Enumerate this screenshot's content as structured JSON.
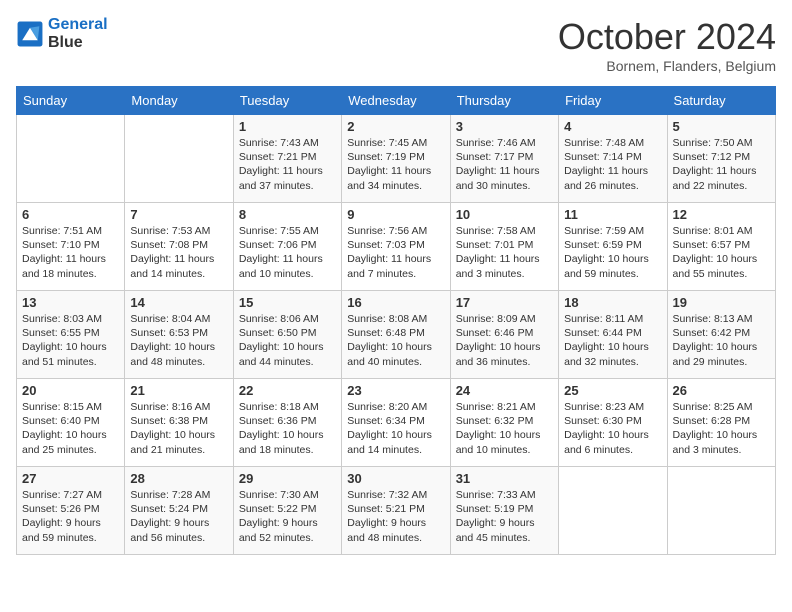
{
  "header": {
    "logo_line1": "General",
    "logo_line2": "Blue",
    "month": "October 2024",
    "location": "Bornem, Flanders, Belgium"
  },
  "days_of_week": [
    "Sunday",
    "Monday",
    "Tuesday",
    "Wednesday",
    "Thursday",
    "Friday",
    "Saturday"
  ],
  "weeks": [
    [
      {
        "day": "",
        "sunrise": "",
        "sunset": "",
        "daylight": ""
      },
      {
        "day": "",
        "sunrise": "",
        "sunset": "",
        "daylight": ""
      },
      {
        "day": "1",
        "sunrise": "Sunrise: 7:43 AM",
        "sunset": "Sunset: 7:21 PM",
        "daylight": "Daylight: 11 hours and 37 minutes."
      },
      {
        "day": "2",
        "sunrise": "Sunrise: 7:45 AM",
        "sunset": "Sunset: 7:19 PM",
        "daylight": "Daylight: 11 hours and 34 minutes."
      },
      {
        "day": "3",
        "sunrise": "Sunrise: 7:46 AM",
        "sunset": "Sunset: 7:17 PM",
        "daylight": "Daylight: 11 hours and 30 minutes."
      },
      {
        "day": "4",
        "sunrise": "Sunrise: 7:48 AM",
        "sunset": "Sunset: 7:14 PM",
        "daylight": "Daylight: 11 hours and 26 minutes."
      },
      {
        "day": "5",
        "sunrise": "Sunrise: 7:50 AM",
        "sunset": "Sunset: 7:12 PM",
        "daylight": "Daylight: 11 hours and 22 minutes."
      }
    ],
    [
      {
        "day": "6",
        "sunrise": "Sunrise: 7:51 AM",
        "sunset": "Sunset: 7:10 PM",
        "daylight": "Daylight: 11 hours and 18 minutes."
      },
      {
        "day": "7",
        "sunrise": "Sunrise: 7:53 AM",
        "sunset": "Sunset: 7:08 PM",
        "daylight": "Daylight: 11 hours and 14 minutes."
      },
      {
        "day": "8",
        "sunrise": "Sunrise: 7:55 AM",
        "sunset": "Sunset: 7:06 PM",
        "daylight": "Daylight: 11 hours and 10 minutes."
      },
      {
        "day": "9",
        "sunrise": "Sunrise: 7:56 AM",
        "sunset": "Sunset: 7:03 PM",
        "daylight": "Daylight: 11 hours and 7 minutes."
      },
      {
        "day": "10",
        "sunrise": "Sunrise: 7:58 AM",
        "sunset": "Sunset: 7:01 PM",
        "daylight": "Daylight: 11 hours and 3 minutes."
      },
      {
        "day": "11",
        "sunrise": "Sunrise: 7:59 AM",
        "sunset": "Sunset: 6:59 PM",
        "daylight": "Daylight: 10 hours and 59 minutes."
      },
      {
        "day": "12",
        "sunrise": "Sunrise: 8:01 AM",
        "sunset": "Sunset: 6:57 PM",
        "daylight": "Daylight: 10 hours and 55 minutes."
      }
    ],
    [
      {
        "day": "13",
        "sunrise": "Sunrise: 8:03 AM",
        "sunset": "Sunset: 6:55 PM",
        "daylight": "Daylight: 10 hours and 51 minutes."
      },
      {
        "day": "14",
        "sunrise": "Sunrise: 8:04 AM",
        "sunset": "Sunset: 6:53 PM",
        "daylight": "Daylight: 10 hours and 48 minutes."
      },
      {
        "day": "15",
        "sunrise": "Sunrise: 8:06 AM",
        "sunset": "Sunset: 6:50 PM",
        "daylight": "Daylight: 10 hours and 44 minutes."
      },
      {
        "day": "16",
        "sunrise": "Sunrise: 8:08 AM",
        "sunset": "Sunset: 6:48 PM",
        "daylight": "Daylight: 10 hours and 40 minutes."
      },
      {
        "day": "17",
        "sunrise": "Sunrise: 8:09 AM",
        "sunset": "Sunset: 6:46 PM",
        "daylight": "Daylight: 10 hours and 36 minutes."
      },
      {
        "day": "18",
        "sunrise": "Sunrise: 8:11 AM",
        "sunset": "Sunset: 6:44 PM",
        "daylight": "Daylight: 10 hours and 32 minutes."
      },
      {
        "day": "19",
        "sunrise": "Sunrise: 8:13 AM",
        "sunset": "Sunset: 6:42 PM",
        "daylight": "Daylight: 10 hours and 29 minutes."
      }
    ],
    [
      {
        "day": "20",
        "sunrise": "Sunrise: 8:15 AM",
        "sunset": "Sunset: 6:40 PM",
        "daylight": "Daylight: 10 hours and 25 minutes."
      },
      {
        "day": "21",
        "sunrise": "Sunrise: 8:16 AM",
        "sunset": "Sunset: 6:38 PM",
        "daylight": "Daylight: 10 hours and 21 minutes."
      },
      {
        "day": "22",
        "sunrise": "Sunrise: 8:18 AM",
        "sunset": "Sunset: 6:36 PM",
        "daylight": "Daylight: 10 hours and 18 minutes."
      },
      {
        "day": "23",
        "sunrise": "Sunrise: 8:20 AM",
        "sunset": "Sunset: 6:34 PM",
        "daylight": "Daylight: 10 hours and 14 minutes."
      },
      {
        "day": "24",
        "sunrise": "Sunrise: 8:21 AM",
        "sunset": "Sunset: 6:32 PM",
        "daylight": "Daylight: 10 hours and 10 minutes."
      },
      {
        "day": "25",
        "sunrise": "Sunrise: 8:23 AM",
        "sunset": "Sunset: 6:30 PM",
        "daylight": "Daylight: 10 hours and 6 minutes."
      },
      {
        "day": "26",
        "sunrise": "Sunrise: 8:25 AM",
        "sunset": "Sunset: 6:28 PM",
        "daylight": "Daylight: 10 hours and 3 minutes."
      }
    ],
    [
      {
        "day": "27",
        "sunrise": "Sunrise: 7:27 AM",
        "sunset": "Sunset: 5:26 PM",
        "daylight": "Daylight: 9 hours and 59 minutes."
      },
      {
        "day": "28",
        "sunrise": "Sunrise: 7:28 AM",
        "sunset": "Sunset: 5:24 PM",
        "daylight": "Daylight: 9 hours and 56 minutes."
      },
      {
        "day": "29",
        "sunrise": "Sunrise: 7:30 AM",
        "sunset": "Sunset: 5:22 PM",
        "daylight": "Daylight: 9 hours and 52 minutes."
      },
      {
        "day": "30",
        "sunrise": "Sunrise: 7:32 AM",
        "sunset": "Sunset: 5:21 PM",
        "daylight": "Daylight: 9 hours and 48 minutes."
      },
      {
        "day": "31",
        "sunrise": "Sunrise: 7:33 AM",
        "sunset": "Sunset: 5:19 PM",
        "daylight": "Daylight: 9 hours and 45 minutes."
      },
      {
        "day": "",
        "sunrise": "",
        "sunset": "",
        "daylight": ""
      },
      {
        "day": "",
        "sunrise": "",
        "sunset": "",
        "daylight": ""
      }
    ]
  ]
}
